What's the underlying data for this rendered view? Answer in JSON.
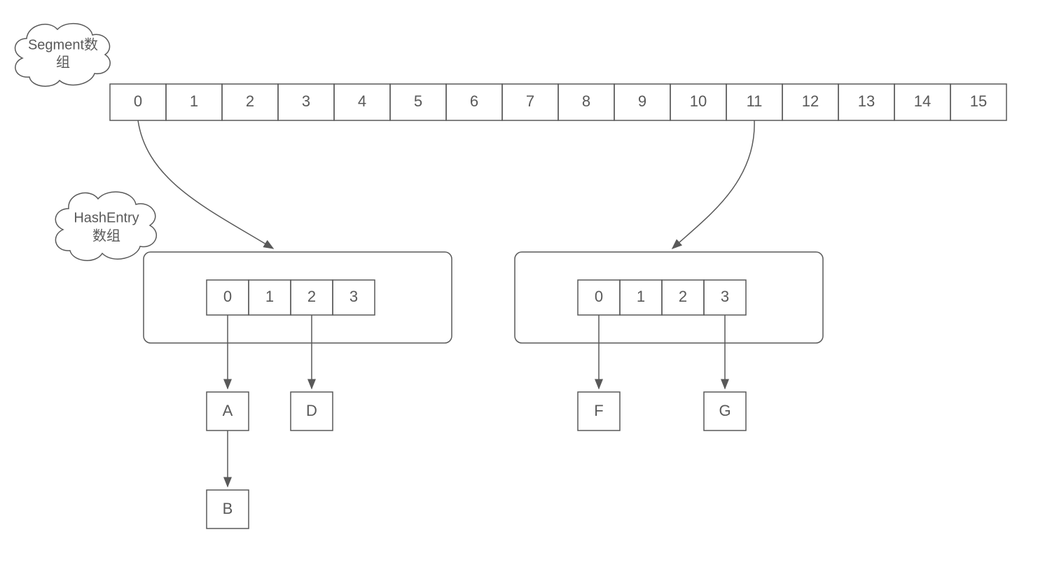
{
  "clouds": {
    "segment": {
      "line1": "Segment数",
      "line2": "组"
    },
    "hashentry": {
      "line1": "HashEntry",
      "line2": "数组"
    }
  },
  "segmentArray": [
    "0",
    "1",
    "2",
    "3",
    "4",
    "5",
    "6",
    "7",
    "8",
    "9",
    "10",
    "11",
    "12",
    "13",
    "14",
    "15"
  ],
  "hashEntryArrayLeft": [
    "0",
    "1",
    "2",
    "3"
  ],
  "hashEntryArrayRight": [
    "0",
    "1",
    "2",
    "3"
  ],
  "nodes": {
    "a": "A",
    "b": "B",
    "d": "D",
    "f": "F",
    "g": "G"
  }
}
